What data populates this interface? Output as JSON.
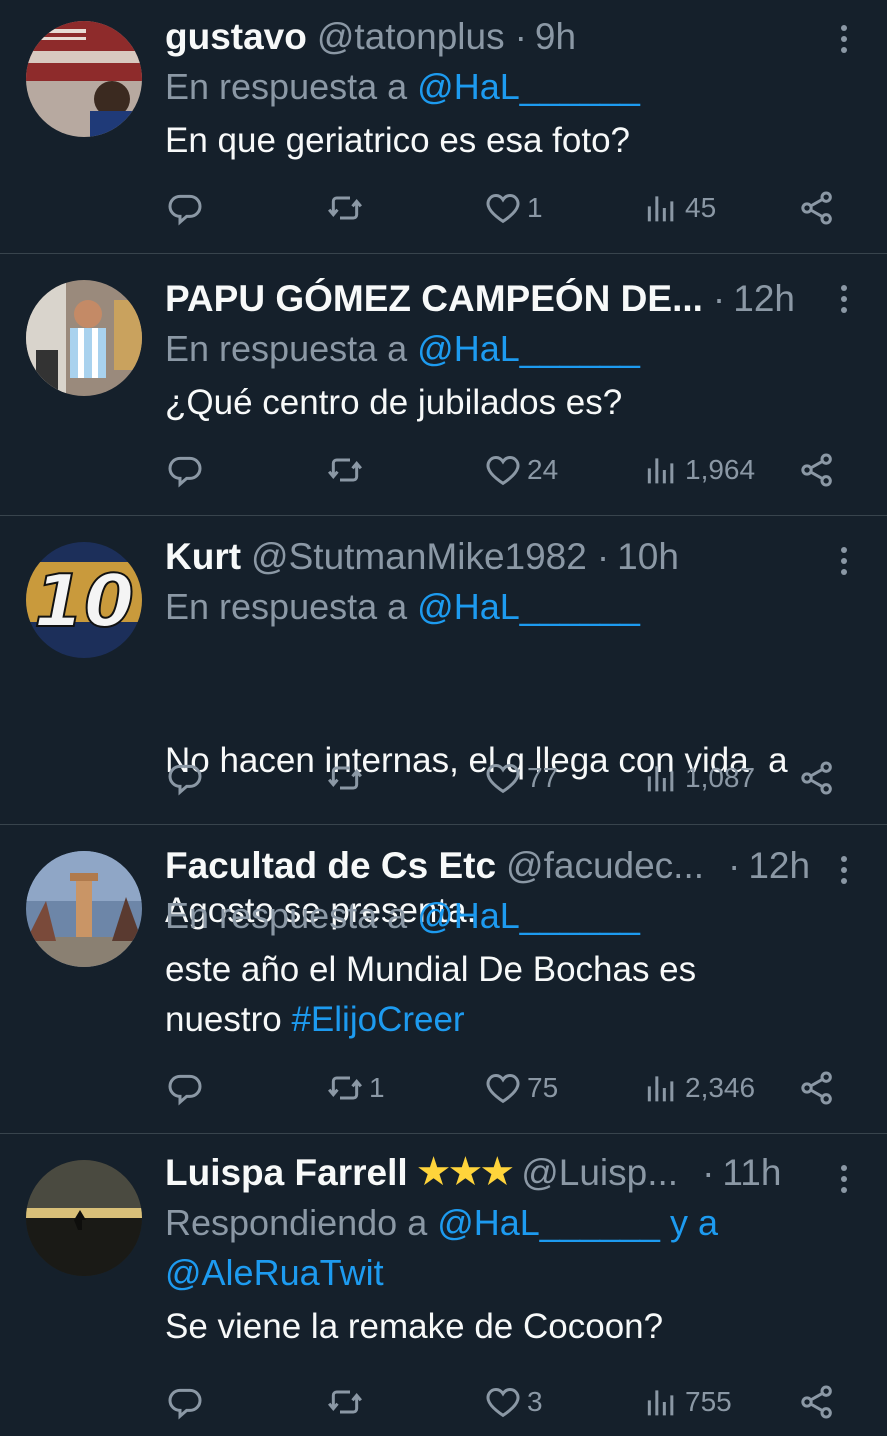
{
  "tweets": [
    {
      "name": "gustavo",
      "handle": "@tatonplus",
      "time": "9h",
      "reply_prefix": "En respuesta a ",
      "reply_mention": "@HaL______",
      "text": "En que geriatrico es esa foto?",
      "replies": "",
      "retweets": "",
      "likes": "1",
      "views": "45"
    },
    {
      "name": "PAPU GÓMEZ CAMPEÓN DE...",
      "handle": "",
      "time": "12h",
      "reply_prefix": "En respuesta a ",
      "reply_mention": "@HaL______",
      "text": "¿Qué centro de jubilados es?",
      "replies": "",
      "retweets": "",
      "likes": "24",
      "views": "1,964"
    },
    {
      "name": "Kurt",
      "handle": "@StutmanMike1982",
      "time": "10h",
      "reply_prefix": "En respuesta a ",
      "reply_mention": "@HaL______",
      "text_line1": "No hacen internas, el q llega con vida  a",
      "text_line2": "Agosto se presenta.",
      "replies": "",
      "retweets": "",
      "likes": "77",
      "views": "1,087"
    },
    {
      "name": "Facultad de Cs Etc",
      "handle": "@facudec...",
      "time": "12h",
      "reply_prefix": "En respuesta a ",
      "reply_mention": "@HaL______",
      "text_line1": "este año el Mundial De Bochas es",
      "text_line2_prefix": "nuestro ",
      "hashtag": "#ElijoCreer",
      "replies": "",
      "retweets": "1",
      "likes": "75",
      "views": "2,346"
    },
    {
      "name": "Luispa Farrell",
      "stars": "★★★",
      "handle": "@Luisp...",
      "time": "11h",
      "reply_prefix": "Respondiendo a ",
      "reply_mention": "@HaL______",
      "reply_and": " y a",
      "reply_mention2": "@AleRuaTwit",
      "text": "Se viene la remake de Cocoon?",
      "replies": "",
      "retweets": "",
      "likes": "3",
      "views": "755"
    }
  ],
  "dot_separator": "·",
  "icons": {
    "reply": "reply-icon",
    "retweet": "retweet-icon",
    "like": "heart-icon",
    "views": "views-icon",
    "share": "share-icon",
    "more": "more-icon"
  },
  "colors": {
    "background": "#15202b",
    "text": "#f7f9f9",
    "muted": "#8b98a5",
    "accent": "#1d9bf0",
    "divider": "#38444d"
  }
}
